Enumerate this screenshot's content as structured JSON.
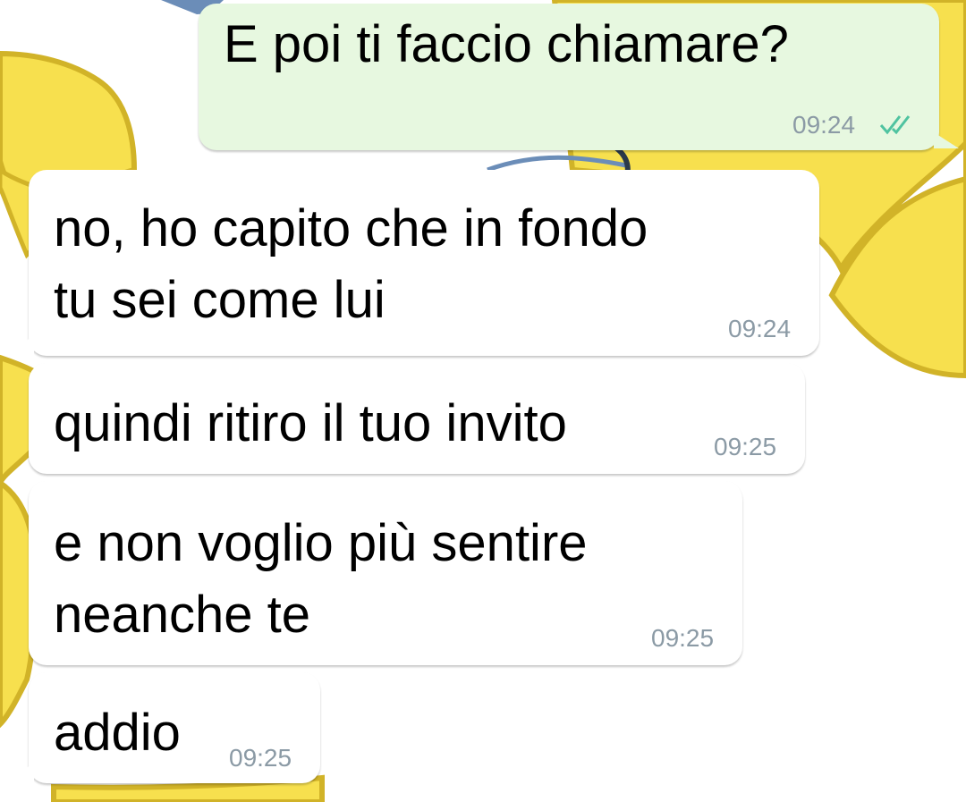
{
  "chat": {
    "wallpaper": {
      "icon": "yellow-duck-icon",
      "colors": {
        "yellow": "#f7e04e",
        "outline": "#d1b328",
        "white": "#ffffff",
        "blue": "#6b8db8"
      }
    },
    "colors": {
      "outgoing_bubble": "#e7f8e0",
      "incoming_bubble": "#ffffff",
      "text": "#000000",
      "time": "#8b9aa5",
      "read_tick": "#4fc3a0"
    },
    "messages": [
      {
        "direction": "outgoing",
        "text": "E poi ti faccio chiamare?",
        "time": "09:24",
        "status_icon": "double-check-read-icon"
      },
      {
        "direction": "incoming",
        "text": "no, ho capito che in fondo\ntu sei come lui",
        "time": "09:24"
      },
      {
        "direction": "incoming",
        "text": "quindi ritiro il tuo invito",
        "time": "09:25"
      },
      {
        "direction": "incoming",
        "text": "e non voglio più sentire\nneanche te",
        "time": "09:25"
      },
      {
        "direction": "incoming",
        "text": "addio",
        "time": "09:25"
      }
    ]
  }
}
